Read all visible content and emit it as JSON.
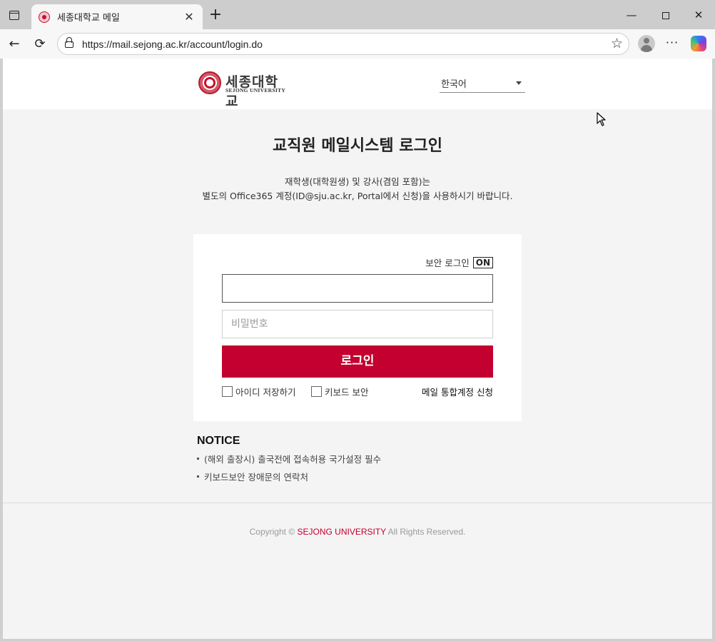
{
  "browser": {
    "tab_title": "세종대학교 메일",
    "tab_close": "✕",
    "new_tab": "+",
    "url": "https://mail.sejong.ac.kr/account/login.do",
    "back": "←",
    "reload": "⟳",
    "star": "☆",
    "more": "···",
    "minimize": "—",
    "close": "✕"
  },
  "header": {
    "logo_korean": "세종대학교",
    "logo_english": "SEJONG UNIVERSITY",
    "language": "한국어"
  },
  "main": {
    "title": "교직원 메일시스템 로그인",
    "subtitle_line1": "재학생(대학원생) 및 강사(겸임 포함)는",
    "subtitle_line2": "별도의 Office365 계정(ID@sju.ac.kr, Portal에서 신청)을 사용하시기 바랍니다."
  },
  "login": {
    "secure_label": "보안 로그인",
    "secure_state": "ON",
    "id_value": "",
    "password_placeholder": "비밀번호",
    "button": "로그인",
    "save_id": "아이디 저장하기",
    "keyboard_security": "키보드 보안",
    "apply_link": "메일 통합계정 신청"
  },
  "notice": {
    "title": "NOTICE",
    "items": [
      "(해외 출장시) 출국전에 접속허용 국가설정 필수",
      "키보드보안 장애문의 연락처"
    ]
  },
  "footer": {
    "prefix": "Copyright © ",
    "brand": "SEJONG UNIVERSITY",
    "suffix": " All Rights Reserved."
  },
  "colors": {
    "brand_red": "#c3002f",
    "page_bg": "#f4f4f4"
  }
}
